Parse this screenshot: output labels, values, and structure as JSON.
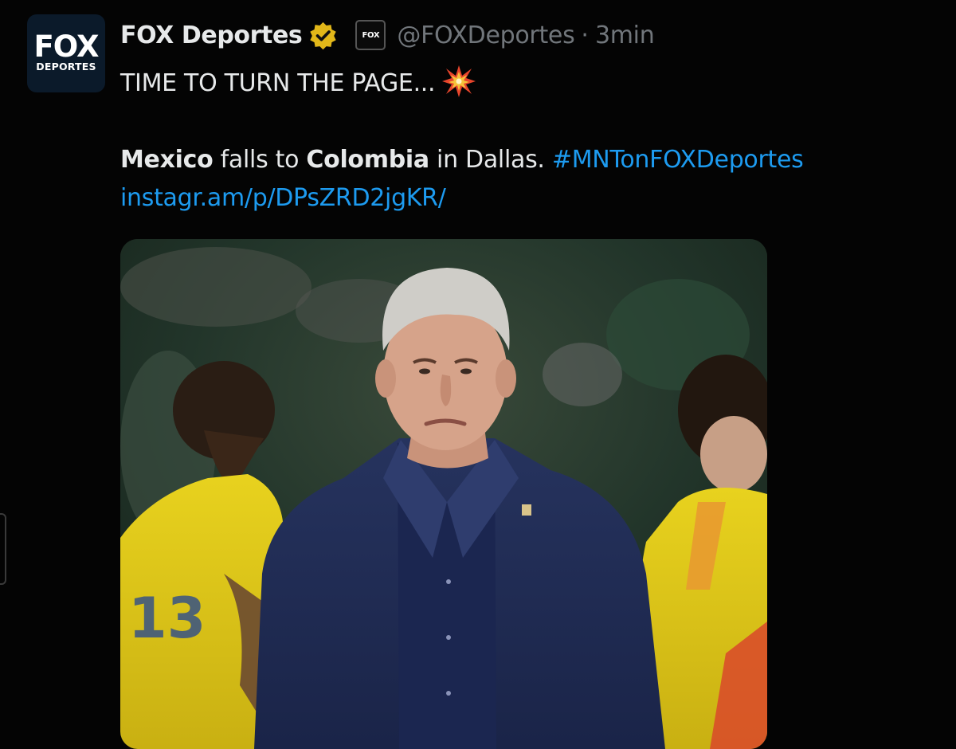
{
  "post": {
    "avatar_text_top": "FOX",
    "avatar_text_bottom": "DEPORTES",
    "author_name": "FOX Deportes",
    "org_badge_text": "FOX",
    "handle": "@FOXDeportes",
    "separator": "·",
    "time": "3min",
    "line1_text": "TIME TO TURN THE PAGE...",
    "line2": {
      "part1_bold": "Mexico",
      "part2": " falls to ",
      "part3_bold": "Colombia",
      "part4": " in Dallas. ",
      "hashtag": "#MNTonFOXDeportes"
    },
    "url": "instagr.am/p/DPsZRD2jgKR/"
  },
  "icons": {
    "verified": "verified-gold-badge-icon",
    "burst": "collision-burst-emoji"
  },
  "colors": {
    "background": "#040404",
    "text": "#e7e9ea",
    "muted": "#71767b",
    "link": "#1d9bf0",
    "verified_gold": "#e2b719"
  }
}
